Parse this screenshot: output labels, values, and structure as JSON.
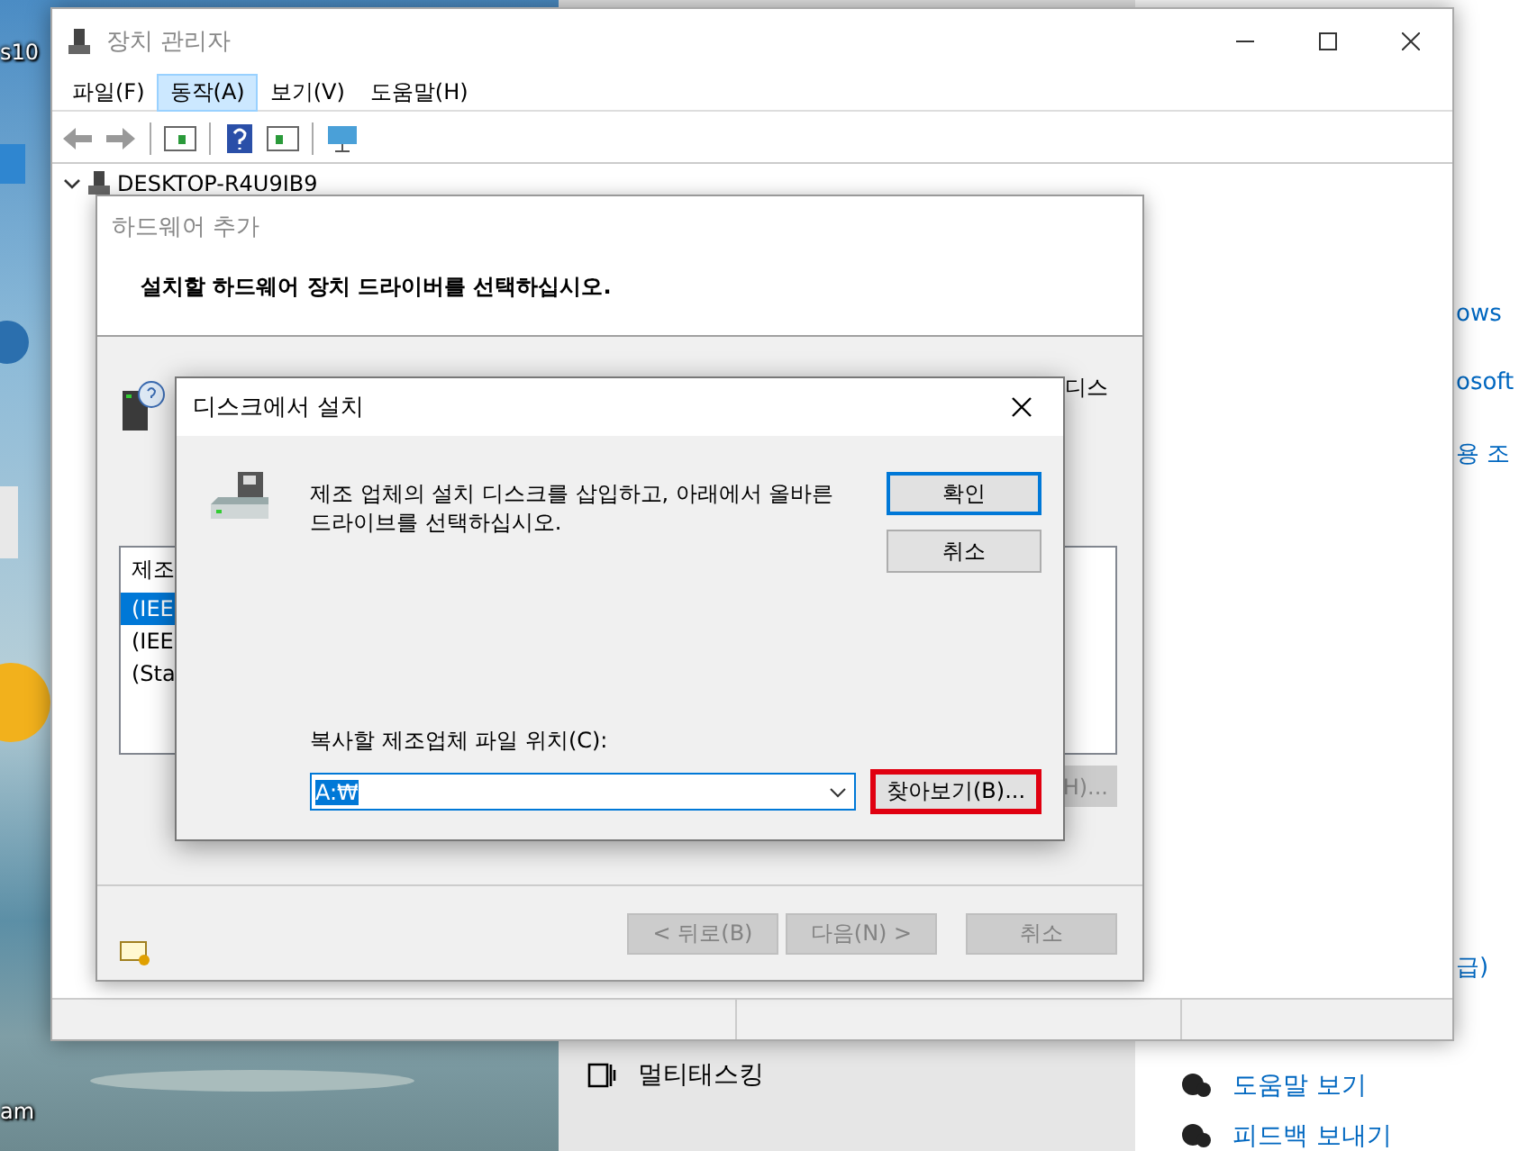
{
  "desktop": {
    "icon_labels": [
      "s10",
      "am"
    ]
  },
  "settings_window": {
    "links": [
      "ows",
      "osoft",
      "용 조",
      "급)"
    ],
    "menu_item": "멀티태스킹",
    "help_links": [
      "도움말 보기",
      "피드백 보내기"
    ]
  },
  "device_manager": {
    "title": "장치 관리자",
    "menu": [
      {
        "label": "파일(F)",
        "selected": false
      },
      {
        "label": "동작(A)",
        "selected": true
      },
      {
        "label": "보기(V)",
        "selected": false
      },
      {
        "label": "도움말(H)",
        "selected": false
      }
    ],
    "tree": [
      {
        "label": "DESKTOP-R4U9IB9",
        "expanded": true
      }
    ]
  },
  "wizard": {
    "title": "하드웨어 추가",
    "heading": "설치할 하드웨어 장치 드라이버를 선택하십시오.",
    "side_text": "디스",
    "list": {
      "header": "제조",
      "items": [
        {
          "label": "(IEE",
          "selected": true
        },
        {
          "label": "(IEE",
          "selected": false
        },
        {
          "label": "(Sta",
          "selected": false
        }
      ]
    },
    "have_disk_button": "H)...",
    "buttons": [
      {
        "label": "< 뒤로(B)",
        "disabled": true
      },
      {
        "label": "다음(N) >",
        "disabled": true
      },
      {
        "label": "취소",
        "disabled": true
      }
    ]
  },
  "disk_dialog": {
    "title": "디스크에서 설치",
    "message": "제조 업체의 설치 디스크를 삽입하고, 아래에서 올바른\n드라이브를 선택하십시오.",
    "ok": "확인",
    "cancel": "취소",
    "location_label": "복사할 제조업체 파일 위치(C):",
    "location_value": "A:₩",
    "browse": "찾아보기(B)...",
    "browse_highlighted": true
  }
}
